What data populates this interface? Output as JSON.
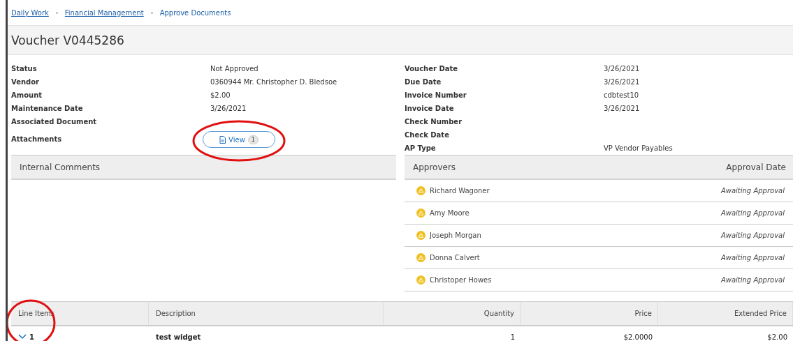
{
  "breadcrumbs": [
    {
      "label": "Daily Work",
      "link": true
    },
    {
      "label": "Financial Management",
      "link": true
    },
    {
      "label": "Approve Documents",
      "link": false
    }
  ],
  "title": "Voucher V0445286",
  "fields_left": [
    {
      "label": "Status",
      "value": "Not Approved"
    },
    {
      "label": "Vendor",
      "value": "0360944 Mr. Christopher D. Bledsoe"
    },
    {
      "label": "Amount",
      "value": "$2.00"
    },
    {
      "label": "Maintenance Date",
      "value": "3/26/2021"
    },
    {
      "label": "Associated Document"
    }
  ],
  "attachments": {
    "label": "Attachments",
    "button": "View",
    "count": "1",
    "highlighted": true
  },
  "fields_right": [
    {
      "label": "Voucher Date",
      "value": "3/26/2021"
    },
    {
      "label": "Due Date",
      "value": "3/26/2021"
    },
    {
      "label": "Invoice Number",
      "value": "cdbtest10"
    },
    {
      "label": "Invoice Date",
      "value": "3/26/2021"
    },
    {
      "label": "Check Number"
    },
    {
      "label": "Check Date"
    },
    {
      "label": "AP Type",
      "value": "VP Vendor Payables"
    }
  ],
  "comments": {
    "title": "Internal Comments"
  },
  "approvers": {
    "columns": [
      "Approvers",
      "Approval Date"
    ],
    "rows": [
      {
        "name": "Richard Wagoner",
        "status": "Awaiting Approval"
      },
      {
        "name": "Amy Moore",
        "status": "Awaiting Approval"
      },
      {
        "name": "Joseph Morgan",
        "status": "Awaiting Approval"
      },
      {
        "name": "Donna Calvert",
        "status": "Awaiting Approval"
      },
      {
        "name": "Christoper Howes",
        "status": "Awaiting Approval"
      }
    ]
  },
  "line_items": {
    "columns": [
      {
        "label": "Line Items",
        "highlighted": true
      },
      {
        "label": "Description",
        "highlighted": false
      },
      {
        "label": "Quantity",
        "highlighted": false
      },
      {
        "label": "Price",
        "highlighted": false
      },
      {
        "label": "Extended Price",
        "highlighted": false
      }
    ],
    "rows": [
      {
        "line": "1",
        "expanded": false,
        "description": "test widget",
        "quantity": "1",
        "price": "$2.0000",
        "extended": "$2.00"
      }
    ]
  }
}
